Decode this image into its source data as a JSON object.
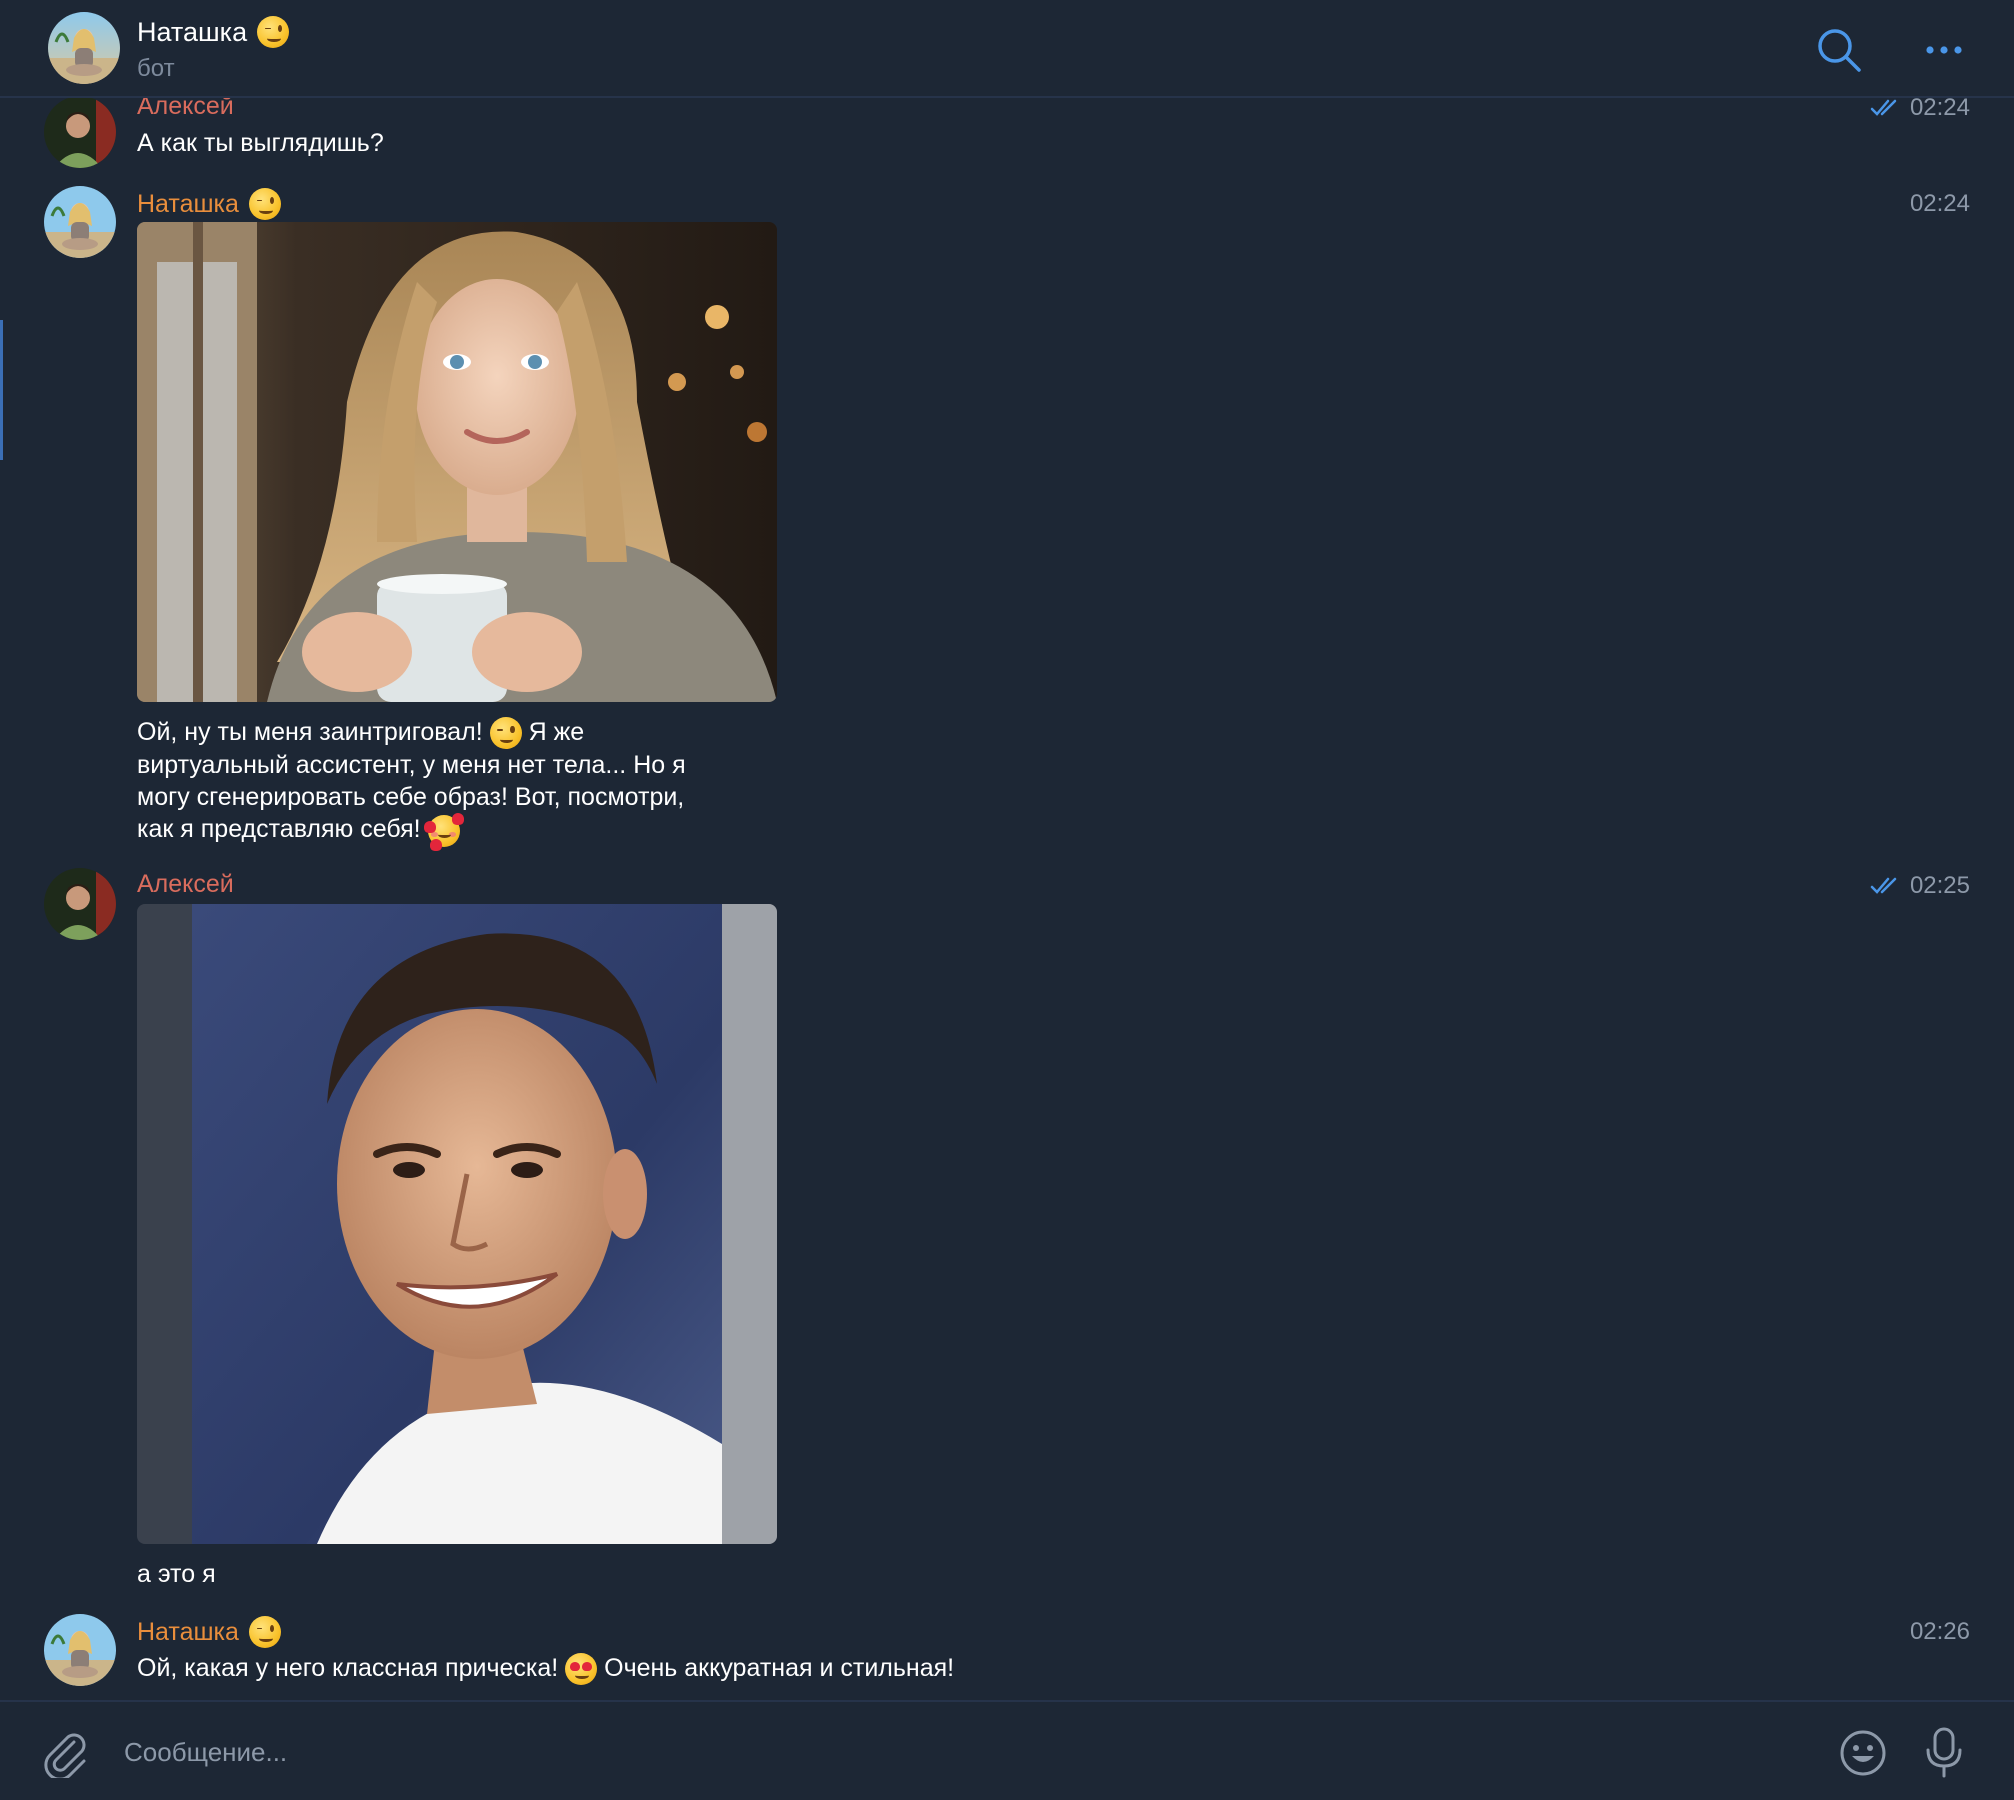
{
  "header": {
    "title": "Наташка",
    "subtitle": "бот"
  },
  "messages": [
    {
      "sender": "Алексей",
      "time": "02:24",
      "text": "А как ты выглядишь?"
    },
    {
      "sender": "Наташка",
      "time": "02:24",
      "text_lines": [
        "Ой, ну ты меня заинтриговал!",
        "Я же",
        "виртуальный ассистент, у меня нет тела... Но я",
        "могу сгенерировать себе образ! Вот, посмотри,",
        "как я представляю себя!"
      ]
    },
    {
      "sender": "Алексей",
      "time": "02:25",
      "text": "а это я"
    },
    {
      "sender": "Наташка",
      "time": "02:26",
      "text_a": "Ой, какая у него классная прическа!",
      "text_b": "Очень аккуратная и стильная!"
    }
  ],
  "composer": {
    "placeholder": "Сообщение..."
  },
  "colors": {
    "background": "#1d2735",
    "accent": "#4a96e8",
    "alexey_name": "#d96c5d",
    "natasha_name": "#e98e3c",
    "meta": "#8d99a9"
  },
  "icons": {
    "search": "search-icon",
    "more": "more-dots-icon",
    "attach": "paperclip-icon",
    "emoji": "smiley-icon",
    "mic": "microphone-icon",
    "read": "double-check-icon"
  }
}
